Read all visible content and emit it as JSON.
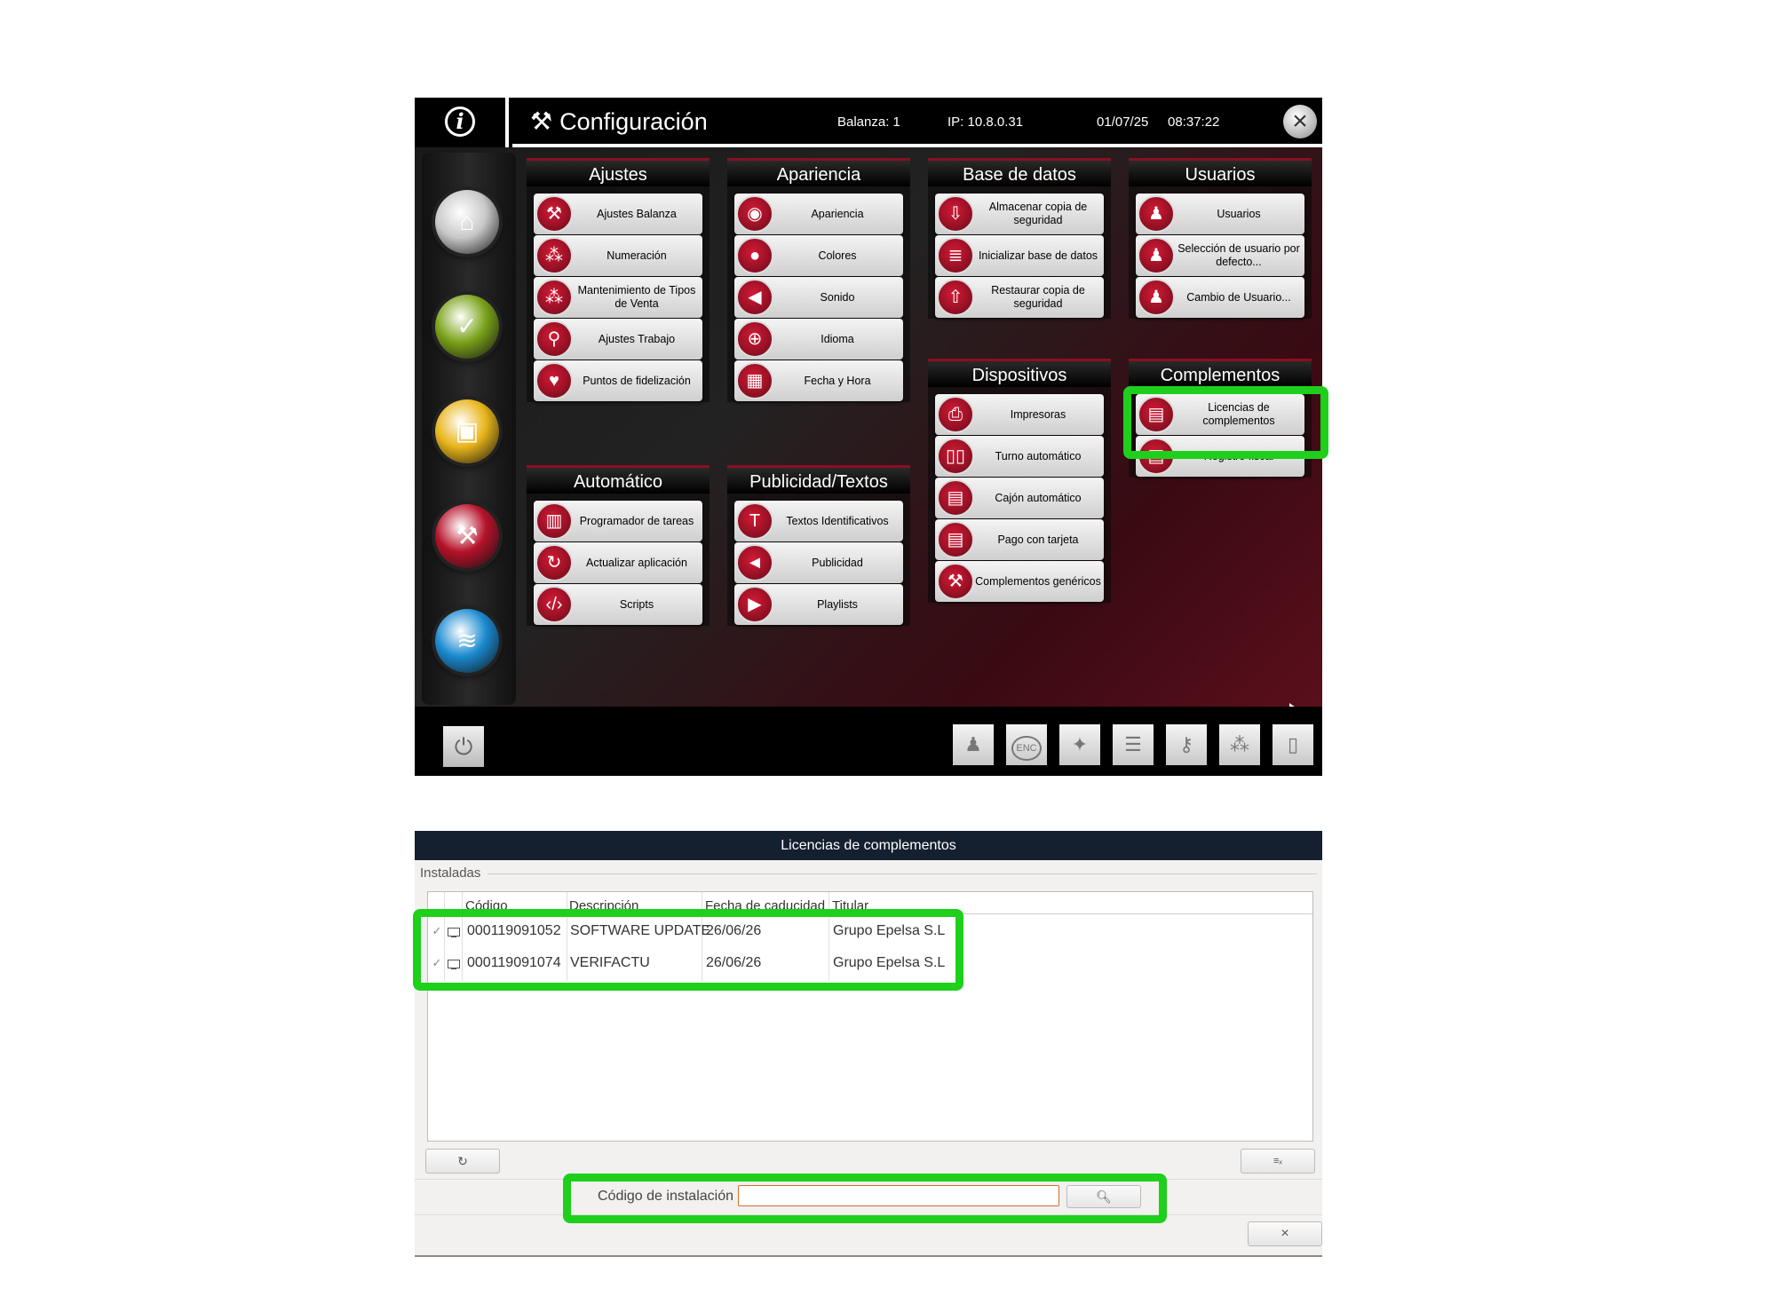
{
  "header": {
    "title": "Configuración",
    "balanza": "Balanza:  1",
    "ip": "IP: 10.8.0.31",
    "date": "01/07/25",
    "time": "08:37:22"
  },
  "sidebar": [
    {
      "name": "home-icon",
      "color": "#c8c8c8"
    },
    {
      "name": "check-icon",
      "color": "#7aa21a"
    },
    {
      "name": "monitor-icon",
      "color": "#e8b41a"
    },
    {
      "name": "tools-icon",
      "color": "#b5122a"
    },
    {
      "name": "wifi-icon",
      "color": "#1a8ad0"
    }
  ],
  "sections": {
    "ajustes": {
      "title": "Ajustes",
      "items": [
        "Ajustes Balanza",
        "Numeración",
        "Mantenimiento de Tipos de Venta",
        "Ajustes Trabajo",
        "Puntos de fidelización"
      ]
    },
    "automatico": {
      "title": "Automático",
      "items": [
        "Programador de tareas",
        "Actualizar aplicación",
        "Scripts"
      ]
    },
    "apariencia": {
      "title": "Apariencia",
      "items": [
        "Apariencia",
        "Colores",
        "Sonido",
        "Idioma",
        "Fecha y Hora"
      ]
    },
    "publicidad": {
      "title": "Publicidad/Textos",
      "items": [
        "Textos Identificativos",
        "Publicidad",
        "Playlists"
      ]
    },
    "base_datos": {
      "title": "Base de datos",
      "items": [
        "Almacenar copia de seguridad",
        "Inicializar base de datos",
        "Restaurar copia de seguridad"
      ]
    },
    "dispositivos": {
      "title": "Dispositivos",
      "items": [
        "Impresoras",
        "Turno automático",
        "Cajón automático",
        "Pago con tarjeta",
        "Complementos genéricos"
      ]
    },
    "usuarios": {
      "title": "Usuarios",
      "items": [
        "Usuarios",
        "Selección de usuario por defecto...",
        "Cambio de Usuario..."
      ]
    },
    "complementos": {
      "title": "Complementos",
      "items": [
        "Licencias de complementos",
        "Registro fiscal"
      ]
    }
  },
  "footer_tools": [
    "help-person-icon",
    "enc-icon",
    "magic-wand-icon",
    "list-code-icon",
    "key-icon",
    "network-icon",
    "document-help-icon"
  ],
  "footer_enc": "ENC",
  "dialog": {
    "title": "Licencias de complementos",
    "installed_label": "Instaladas",
    "columns": [
      "Código",
      "Descripción",
      "Fecha de caducidad",
      "Titular"
    ],
    "rows": [
      {
        "code": "000119091052",
        "description": "SOFTWARE UPDATE",
        "expiry": "26/06/26",
        "holder": "Grupo Epelsa S.L"
      },
      {
        "code": "000119091074",
        "description": "VERIFACTU",
        "expiry": "26/06/26",
        "holder": "Grupo Epelsa S.L"
      }
    ],
    "install_code_label": "Código de instalación",
    "install_code_value": ""
  },
  "highlight_color": "#1ed01b"
}
